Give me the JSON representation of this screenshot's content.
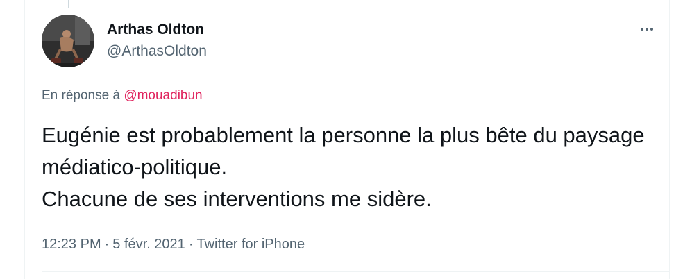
{
  "author": {
    "display_name": "Arthas Oldton",
    "handle": "@ArthasOldton"
  },
  "reply": {
    "prefix": "En réponse à",
    "handle": "@mouadibun"
  },
  "tweet": {
    "text": "Eugénie est probablement la personne la plus bête du paysage médiatico-politique.\nChacune de ses interventions me sidère."
  },
  "meta": {
    "time": "12:23 PM",
    "separator": "·",
    "date": "5 févr. 2021",
    "source": "Twitter for iPhone"
  },
  "icons": {
    "more": "more-horizontal-icon",
    "avatar": "profile-photo"
  },
  "colors": {
    "text": "#0f1419",
    "secondary": "#536471",
    "mention": "#e0245e"
  }
}
